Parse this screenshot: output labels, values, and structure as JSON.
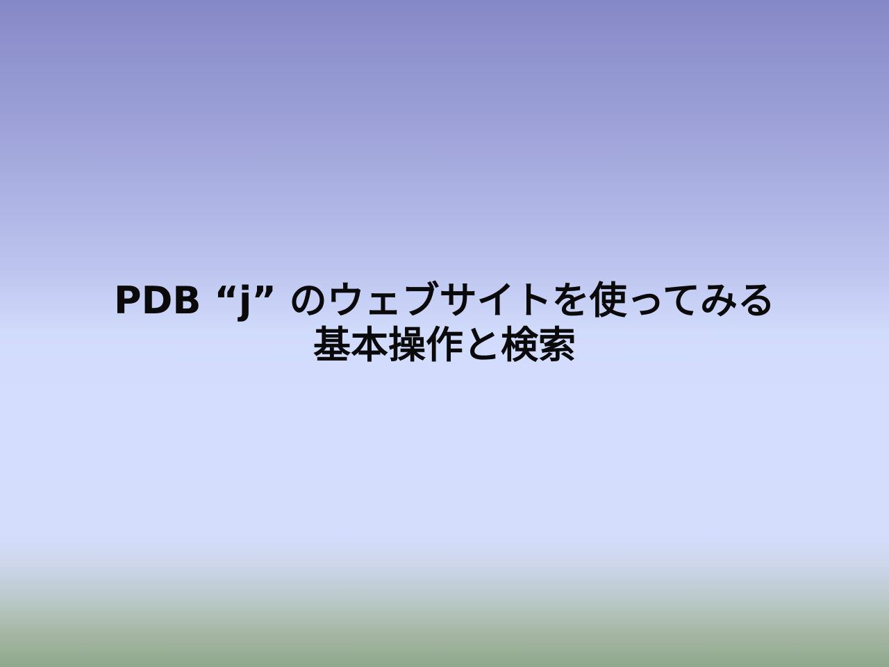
{
  "slide": {
    "title_line_1": "PDB “j” のウェブサイトを使ってみる",
    "title_line_2": "基本操作と検索"
  }
}
